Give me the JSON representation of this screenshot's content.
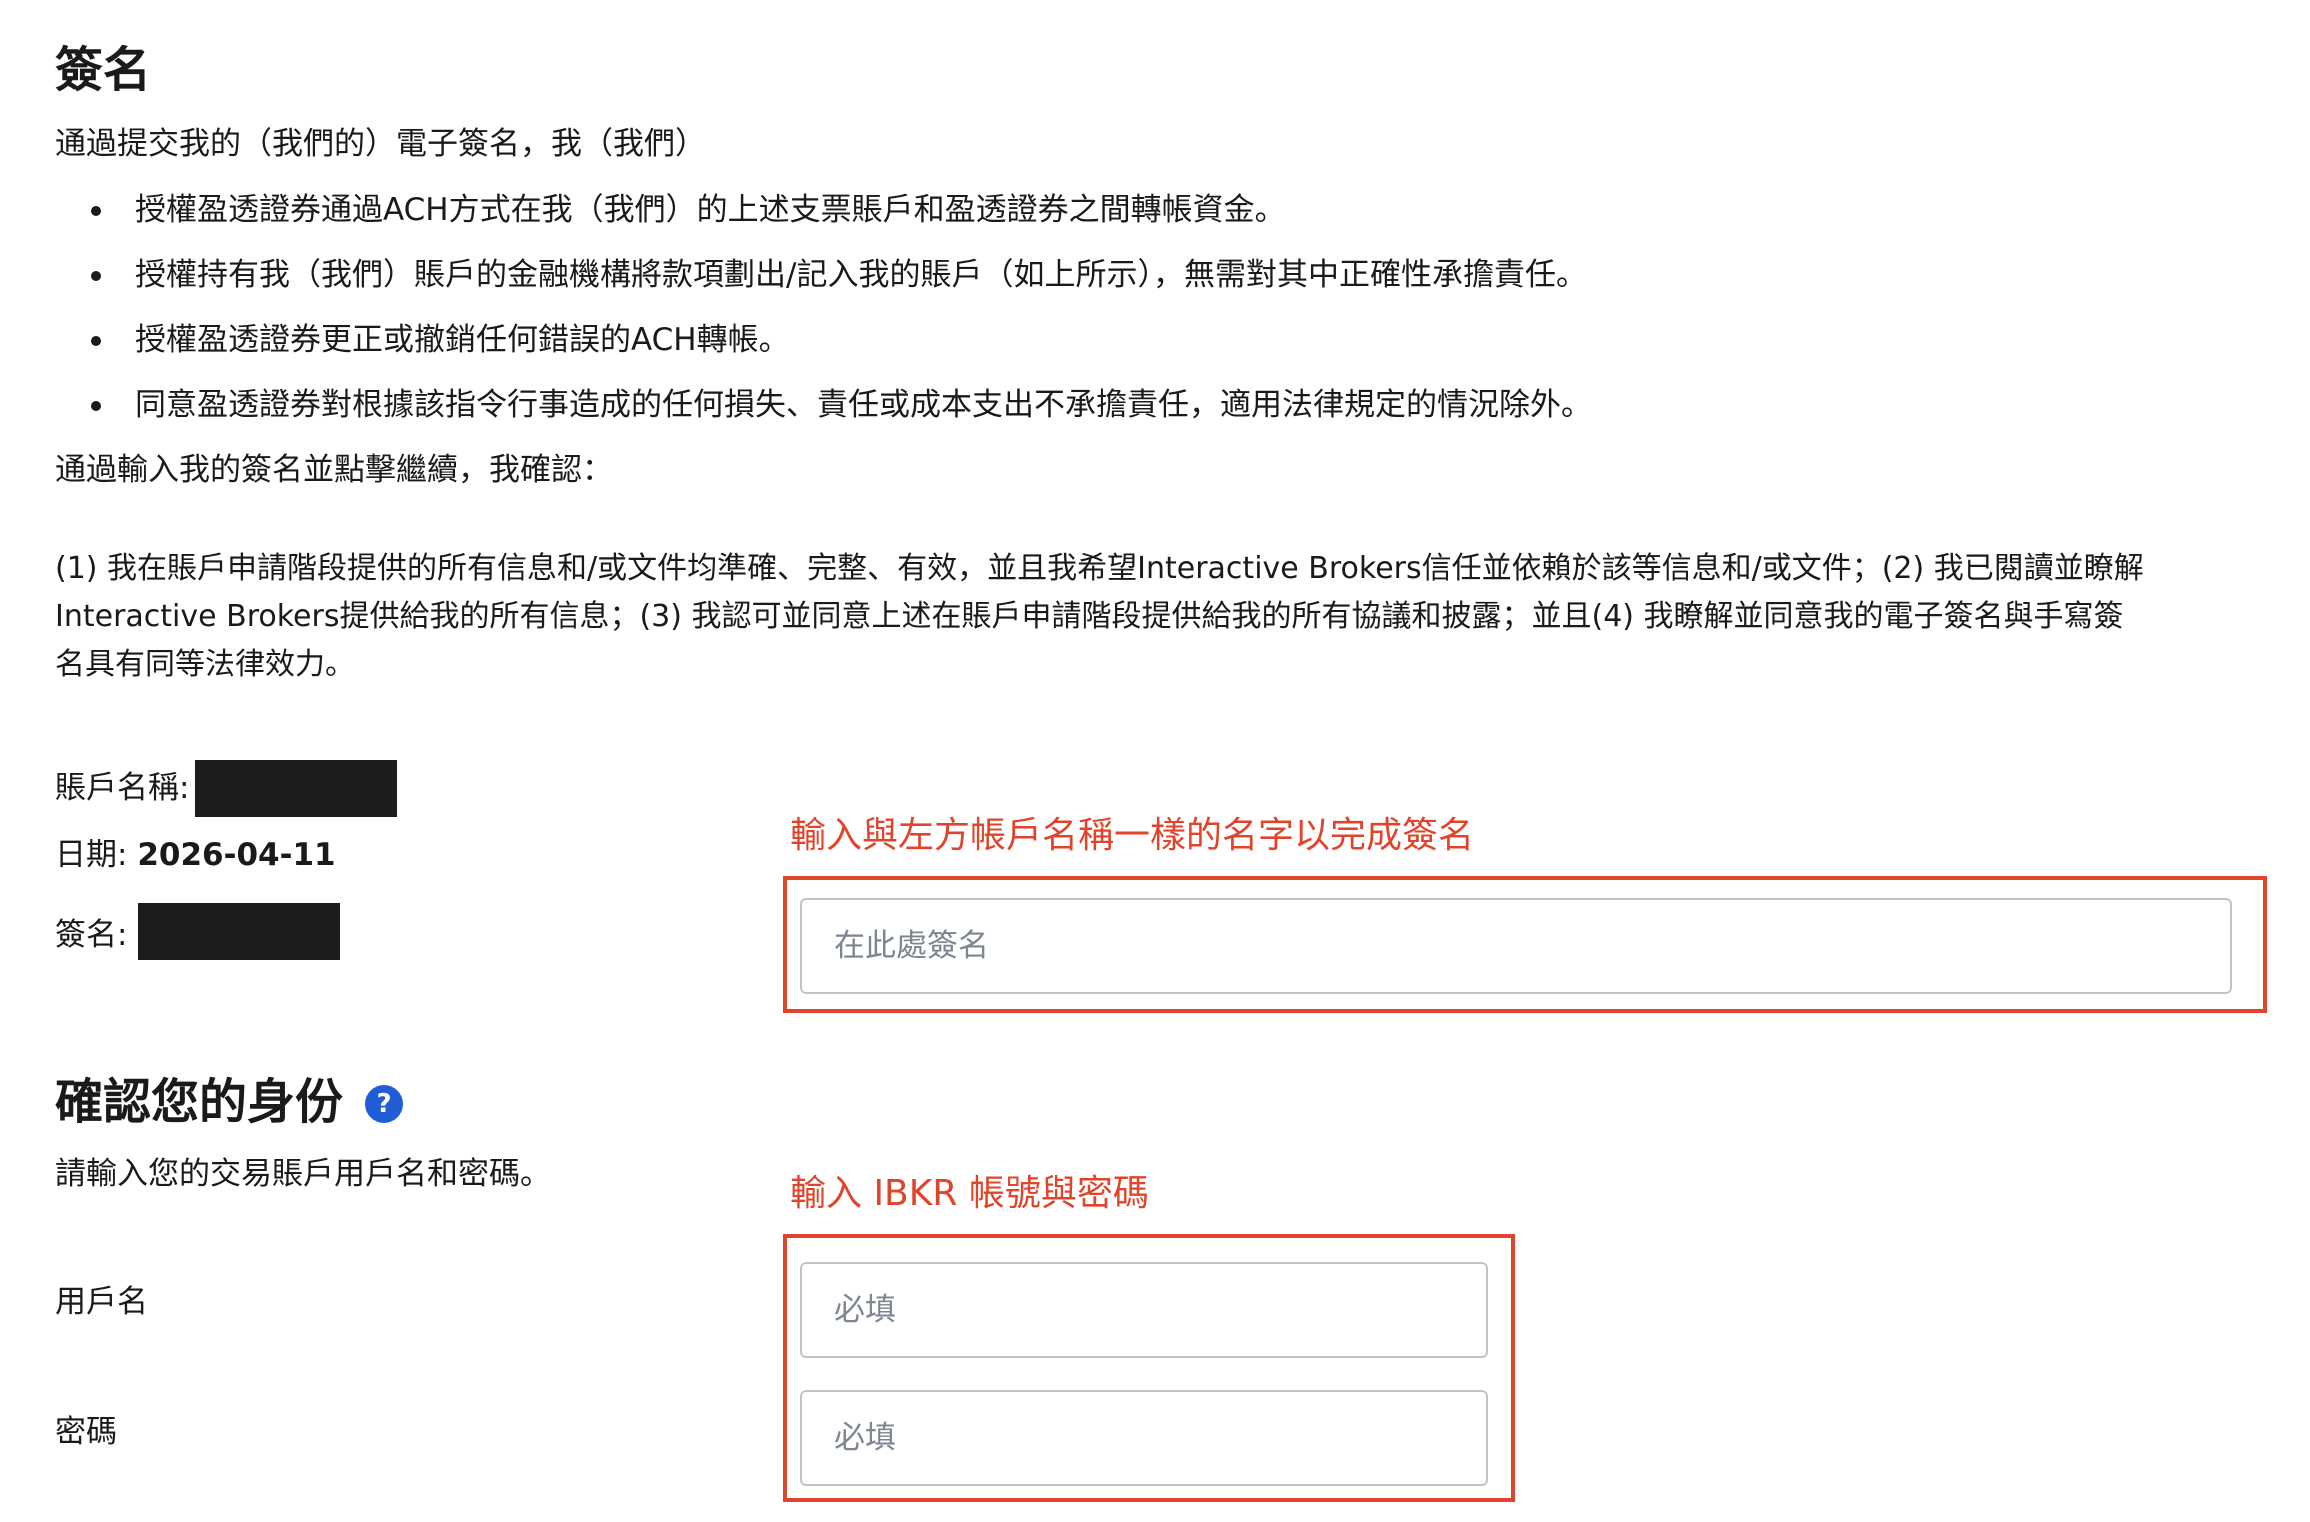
{
  "signature_section": {
    "title": "簽名",
    "intro": "通過提交我的（我們的）電子簽名，我（我們）",
    "bullets": [
      "授權盈透證券通過ACH方式在我（我們）的上述支票賬戶和盈透證券之間轉帳資金。",
      "授權持有我（我們）賬戶的金融機構將款項劃出/記入我的賬戶（如上所示），無需對其中正確性承擔責任。",
      "授權盈透證券更正或撤銷任何錯誤的ACH轉帳。",
      "同意盈透證券對根據該指令行事造成的任何損失、責任或成本支出不承擔責任，適用法律規定的情況除外。"
    ],
    "confirm_intro": "通過輸入我的簽名並點擊繼續，我確認：",
    "acknowledgement_lines": [
      "(1) 我在賬戶申請階段提供的所有信息和/或文件均準確、完整、有效，並且我希望Interactive Brokers信任並依賴於該等信息和/或文件；(2) 我已閱讀並瞭解",
      "Interactive Brokers提供給我的所有信息；(3) 我認可並同意上述在賬戶申請階段提供給我的所有協議和披露；並且(4) 我瞭解並同意我的電子簽名與手寫簽",
      "名具有同等法律效力。"
    ],
    "account_name_label": "賬戶名稱:",
    "date_label": "日期:",
    "date_value": "2026-04-11",
    "signature_label": "簽名:",
    "signature_placeholder": "在此處簽名",
    "annotation": "輸入與左方帳戶名稱一樣的名字以完成簽名"
  },
  "identity_section": {
    "title": "確認您的身份",
    "help_icon": "?",
    "instruction": "請輸入您的交易賬戶用戶名和密碼。",
    "username_label": "用戶名",
    "username_placeholder": "必填",
    "password_label": "密碼",
    "password_placeholder": "必填",
    "annotation": "輸入 IBKR 帳號與密碼"
  },
  "colors": {
    "annotation_red": "#e0452b",
    "help_blue": "#1f5cd6",
    "redaction": "#1c1c1c"
  }
}
